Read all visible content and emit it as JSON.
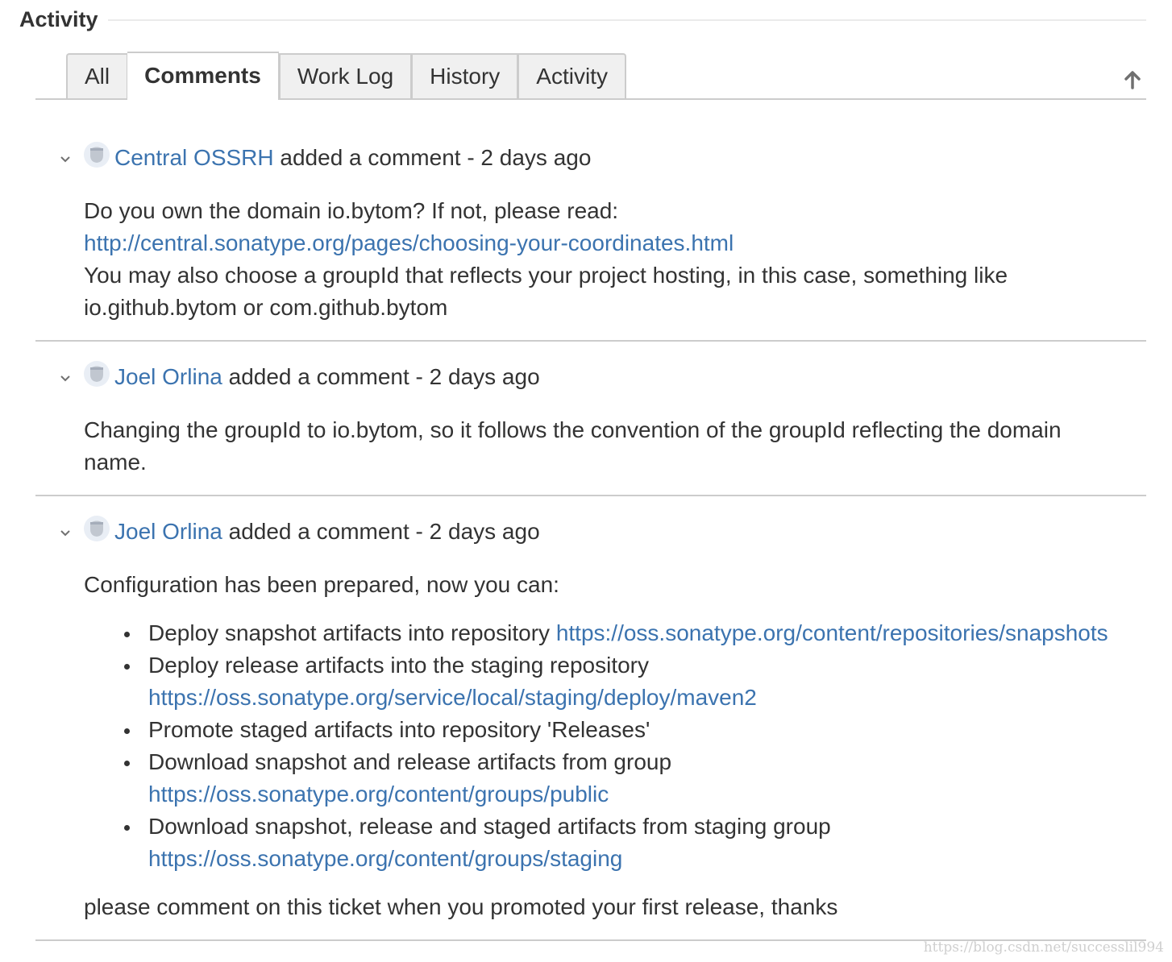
{
  "module": {
    "title": "Activity"
  },
  "tabs": [
    {
      "label": "All",
      "active": false
    },
    {
      "label": "Comments",
      "active": true
    },
    {
      "label": "Work Log",
      "active": false
    },
    {
      "label": "History",
      "active": false
    },
    {
      "label": "Activity",
      "active": false
    }
  ],
  "scroll_top_icon": "arrow-up-icon",
  "colors": {
    "link": "#3b73af",
    "text": "#333333",
    "tab_bg": "#f0f0f0",
    "border": "#cccccc"
  },
  "comments": [
    {
      "author": "Central OSSRH",
      "action": " added a comment - 2 days ago",
      "body": {
        "line1": "Do you own the domain io.bytom? If not, please read:",
        "link1": "http://central.sonatype.org/pages/choosing-your-coordinates.html",
        "line2": "You may also choose a groupId that reflects your project hosting, in this case, something like",
        "line3": "io.github.bytom or com.github.bytom"
      }
    },
    {
      "author": "Joel Orlina",
      "action": " added a comment - 2 days ago",
      "body": {
        "line1": "Changing the groupId to io.bytom, so it follows the convention of the groupId reflecting the domain",
        "line2": "name."
      }
    },
    {
      "author": "Joel Orlina",
      "action": " added a comment - 2 days ago",
      "body": {
        "intro": "Configuration has been prepared, now you can:",
        "items": [
          {
            "text": "Deploy snapshot artifacts into repository ",
            "link": "https://oss.sonatype.org/content/repositories/snapshots"
          },
          {
            "text": "Deploy release artifacts into the staging repository",
            "link": "https://oss.sonatype.org/service/local/staging/deploy/maven2"
          },
          {
            "text": "Promote staged artifacts into repository 'Releases'",
            "link": ""
          },
          {
            "text": "Download snapshot and release artifacts from group",
            "link": "https://oss.sonatype.org/content/groups/public"
          },
          {
            "text": "Download snapshot, release and staged artifacts from staging group",
            "link": "https://oss.sonatype.org/content/groups/staging"
          }
        ],
        "outro": "please comment on this ticket when you promoted your first release, thanks"
      }
    }
  ],
  "watermark": "https://blog.csdn.net/successlil994"
}
